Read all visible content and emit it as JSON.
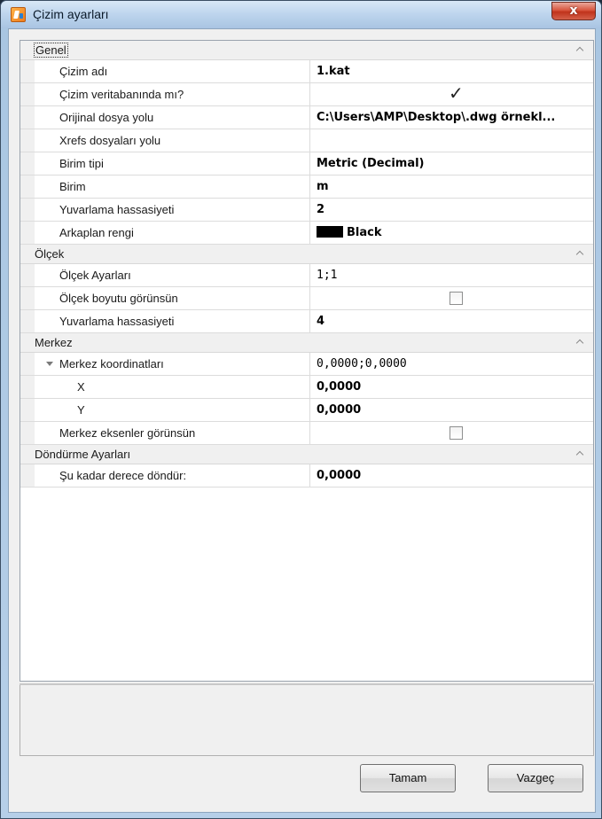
{
  "window": {
    "title": "Çizim ayarları",
    "close_label": "x"
  },
  "categories": [
    {
      "label": "Genel",
      "rows": [
        {
          "name": "Çizim adı",
          "value": "1.kat",
          "bold": true
        },
        {
          "name": "Çizim veritabanında mı?",
          "value": "",
          "checkbox": true,
          "checked": true
        },
        {
          "name": "Orijinal dosya yolu",
          "value": "C:\\Users\\AMP\\Desktop\\.dwg örnekl...",
          "bold": true
        },
        {
          "name": "Xrefs dosyaları yolu",
          "value": ""
        },
        {
          "name": "Birim tipi",
          "value": "Metric (Decimal)",
          "bold": true
        },
        {
          "name": "Birim",
          "value": "m",
          "bold": true
        },
        {
          "name": "Yuvarlama hassasiyeti",
          "value": "2",
          "bold": true
        },
        {
          "name": "Arkaplan rengi",
          "value": "Black",
          "bold": true,
          "swatch": "#000000"
        }
      ]
    },
    {
      "label": "Ölçek",
      "rows": [
        {
          "name": "Ölçek Ayarları",
          "value": "1;1"
        },
        {
          "name": "Ölçek boyutu görünsün",
          "value": "",
          "checkbox": true,
          "checked": false
        },
        {
          "name": "Yuvarlama hassasiyeti",
          "value": "4",
          "bold": true
        }
      ]
    },
    {
      "label": "Merkez",
      "rows": [
        {
          "name": "Merkez koordinatları",
          "value": "0,0000;0,0000",
          "expandable": true
        },
        {
          "name": "X",
          "value": "0,0000",
          "bold": true,
          "indent": 2
        },
        {
          "name": "Y",
          "value": "0,0000",
          "bold": true,
          "indent": 2
        },
        {
          "name": "Merkez eksenler görünsün",
          "value": "",
          "checkbox": true,
          "checked": false
        }
      ]
    },
    {
      "label": "Döndürme Ayarları",
      "rows": [
        {
          "name": "Şu kadar derece döndür:",
          "value": "0,0000",
          "bold": true
        }
      ]
    }
  ],
  "buttons": {
    "ok_label": "Tamam",
    "cancel_label": "Vazgeç"
  }
}
